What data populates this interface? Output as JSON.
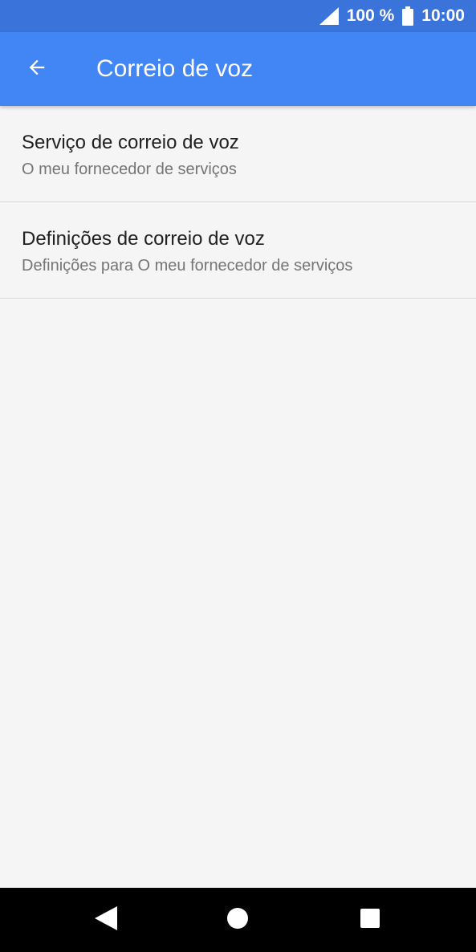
{
  "status_bar": {
    "battery": "100 %",
    "time": "10:00",
    "icons": [
      "signal-icon",
      "battery-icon"
    ]
  },
  "app_bar": {
    "title": "Correio de voz",
    "back_icon": "arrow-back-icon",
    "color": "#4285f4"
  },
  "list": {
    "items": [
      {
        "title": "Serviço de correio de voz",
        "subtitle": "O meu fornecedor de serviços"
      },
      {
        "title": "Definições de correio de voz",
        "subtitle": "Definições para O meu fornecedor de serviços"
      }
    ]
  },
  "nav_bar": {
    "icons": [
      "back-triangle-icon",
      "home-circle-icon",
      "recents-square-icon"
    ]
  }
}
